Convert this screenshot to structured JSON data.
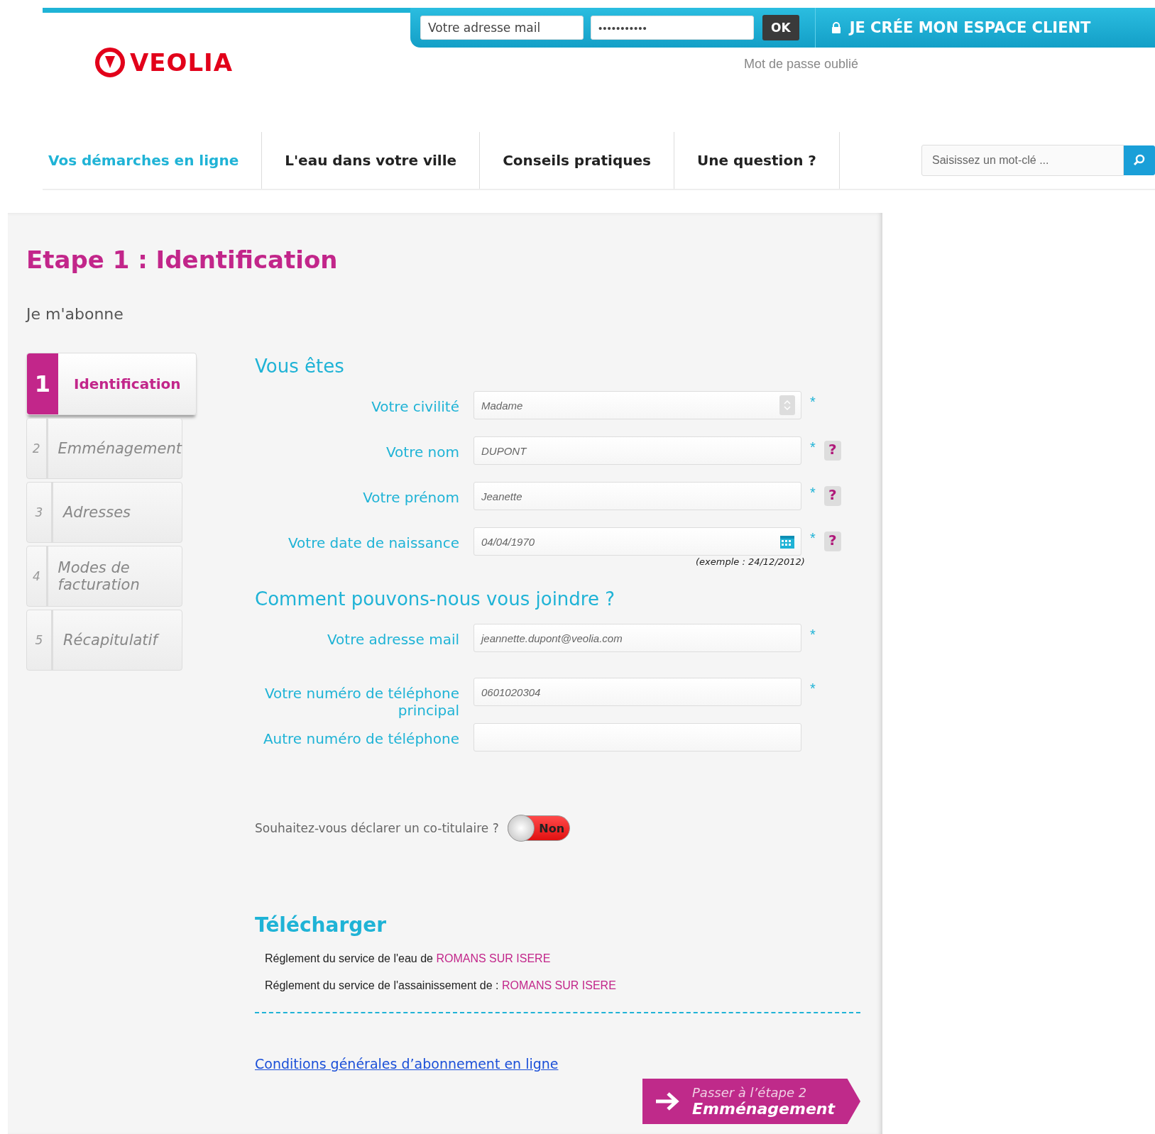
{
  "header": {
    "logo": "VEOLIA",
    "login": {
      "email_placeholder": "Votre adresse mail",
      "password_mask": "•••••••••••",
      "ok": "OK",
      "create_account": "JE CRÉE MON ESPACE CLIENT",
      "forgot": "Mot de passe oublié"
    }
  },
  "nav": [
    {
      "label": "Vos démarches en ligne",
      "selected": true
    },
    {
      "label": "L'eau dans votre ville",
      "selected": false
    },
    {
      "label": "Conseils pratiques",
      "selected": false
    },
    {
      "label": "Une question ?",
      "selected": false
    }
  ],
  "search": {
    "placeholder": "Saisissez un mot-clé ..."
  },
  "page": {
    "title": "Etape 1 : Identification",
    "subtitle": "Je m'abonne"
  },
  "steps": [
    {
      "number": "1",
      "label": "Identification",
      "selected": true
    },
    {
      "number": "2",
      "label": "Emménagement",
      "selected": false
    },
    {
      "number": "3",
      "label": "Adresses",
      "selected": false
    },
    {
      "number": "4",
      "label": "Modes de facturation",
      "selected": false
    },
    {
      "number": "5",
      "label": "Récapitulatif",
      "selected": false
    }
  ],
  "sections": [
    {
      "title": "Vous êtes",
      "fields": [
        {
          "label": "Votre civilité",
          "kind": "select",
          "value": "Madame",
          "required": true
        },
        {
          "label": "Votre nom",
          "kind": "text",
          "placeholder": "DUPONT",
          "required": true,
          "help": true
        },
        {
          "label": "Votre prénom",
          "kind": "text",
          "placeholder": "Jeanette",
          "required": true,
          "help": true
        },
        {
          "label": "Votre date de naissance",
          "kind": "date",
          "placeholder": "04/04/1970",
          "required": true,
          "help": true,
          "hint": "(exemple : 24/12/2012)"
        }
      ]
    },
    {
      "title": "Comment pouvons-nous vous joindre ?",
      "fields": [
        {
          "label": "Votre adresse mail",
          "kind": "text",
          "placeholder": "jeannette.dupont@veolia.com",
          "required": true
        },
        {
          "label": "Votre numéro de téléphone principal",
          "kind": "text",
          "placeholder": "0601020304",
          "required": true
        },
        {
          "label": "Autre numéro de téléphone",
          "kind": "text",
          "required": false
        }
      ]
    }
  ],
  "required_mark": "*",
  "help_mark": "?",
  "cotitulaire": {
    "question": "Souhaitez-vous déclarer un co-titulaire ?",
    "on": false,
    "state_text": "Non"
  },
  "downloads": {
    "title": "Télécharger",
    "items": [
      {
        "text": "Réglement du service de l'eau de",
        "link": "ROMANS SUR ISERE"
      },
      {
        "text": "Réglement du service de l'assainissement de :",
        "link": "ROMANS SUR ISERE"
      }
    ]
  },
  "conditions_link": "Conditions générales d’abonnement en ligne",
  "next_button": {
    "line1": "Passer à l’étape 2",
    "line2": "Emménagement"
  }
}
